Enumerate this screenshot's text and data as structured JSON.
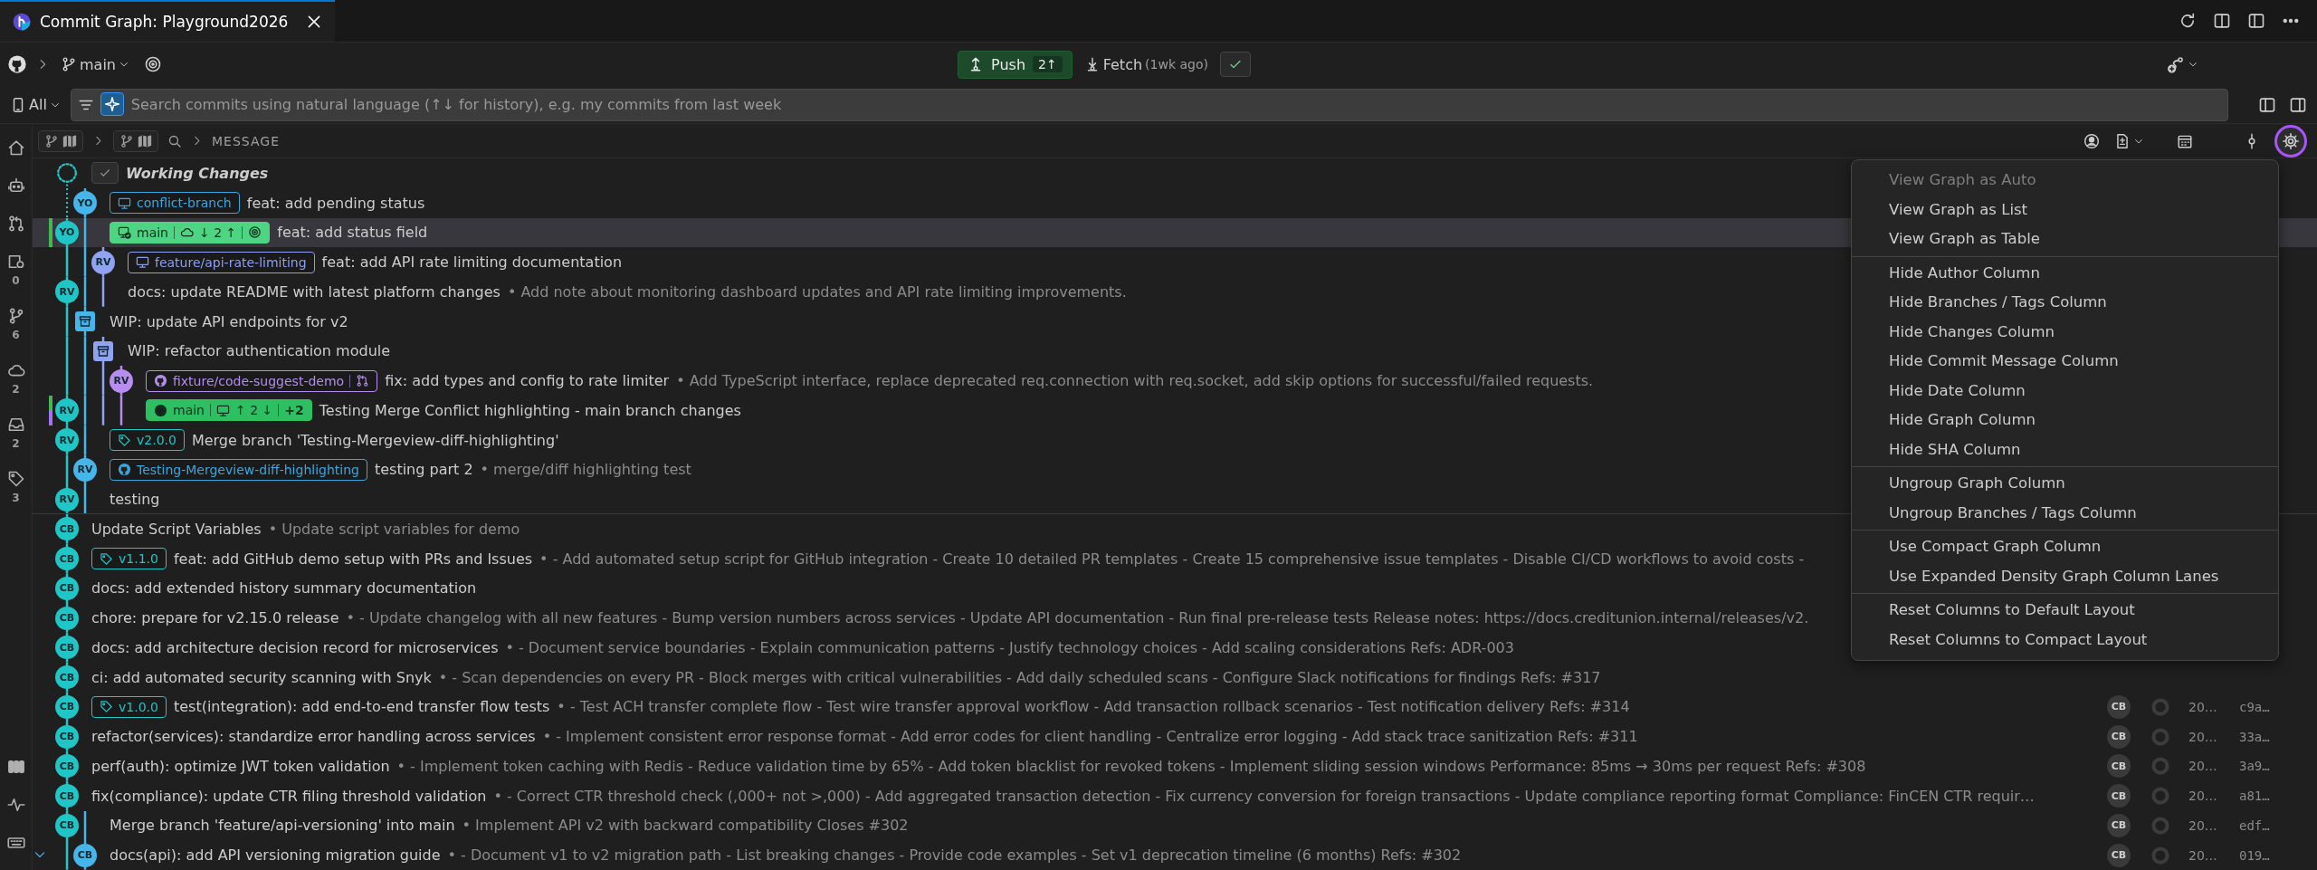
{
  "tab": {
    "title": "Commit Graph: Playground2026",
    "selected": true
  },
  "toolbar": {
    "branch": "main",
    "push": {
      "label": "Push",
      "badge": "2↑"
    },
    "fetch": {
      "label": "Fetch",
      "age": "(1wk ago)"
    }
  },
  "search": {
    "scope": "All",
    "placeholder": "Search commits using natural language (↑↓ for history), e.g. my commits from last week",
    "ai_on": true
  },
  "activity_bar": {
    "top": [
      {
        "kind": "home"
      },
      {
        "kind": "robot"
      },
      {
        "kind": "pull-request"
      },
      {
        "kind": "worktree",
        "count": "0"
      },
      {
        "kind": "branch",
        "count": "6"
      },
      {
        "kind": "cloud",
        "count": "2"
      },
      {
        "kind": "inbox",
        "count": "2"
      },
      {
        "kind": "tag",
        "count": "3"
      }
    ],
    "bottom": [
      {
        "kind": "columns"
      },
      {
        "kind": "pulse"
      },
      {
        "kind": "keyboard"
      }
    ]
  },
  "header": {
    "view_toggles": [
      {
        "selected": true
      },
      {
        "selected": true
      }
    ],
    "message_column": "MESSAGE",
    "settings_highlighted": true
  },
  "rows": [
    {
      "kind": "working",
      "selected": false,
      "summary": "Working Changes"
    },
    {
      "kind": "commit",
      "author": "YO",
      "selected": false,
      "refs": [
        {
          "kind": "local",
          "name": "conflict-branch",
          "color": "#3aa6e0",
          "filled": false
        }
      ],
      "summary": "feat: add pending status"
    },
    {
      "kind": "commit",
      "author": "YO",
      "selected": true,
      "markers": [
        {
          "color": "#3fb950"
        }
      ],
      "refs": [
        {
          "kind": "current",
          "name": "main",
          "color": "#4fd483",
          "filled": true,
          "parts": [
            {
              "kind": "remote",
              "text": "↓ 2 ↑"
            },
            {
              "kind": "upstream"
            }
          ]
        }
      ],
      "summary": "feat: add status field"
    },
    {
      "kind": "commit",
      "author": "RV",
      "selected": false,
      "refs": [
        {
          "kind": "local",
          "name": "feature/api-rate-limiting",
          "color": "#8d9ef0",
          "filled": false
        }
      ],
      "summary": "feat: add API rate limiting documentation"
    },
    {
      "kind": "commit",
      "author": "RV",
      "selected": false,
      "summary": "docs: update README with latest platform changes",
      "description": "• Add note about monitoring dashboard updates and API rate limiting improvements."
    },
    {
      "kind": "stash",
      "selected": false,
      "summary": "WIP: update API endpoints for v2"
    },
    {
      "kind": "stash",
      "selected": false,
      "summary": "WIP: refactor authentication module"
    },
    {
      "kind": "commit",
      "author": "RV",
      "selected": false,
      "refs": [
        {
          "kind": "remote",
          "name": "fixture/code-suggest-demo",
          "color": "#b48cf0",
          "filled": false,
          "parts": [
            {
              "kind": "pull-request"
            }
          ]
        }
      ],
      "summary": "fix: add types and config to rate limiter",
      "description": "• Add TypeScript interface, replace deprecated req.connection with req.socket, add skip options for successful/failed requests."
    },
    {
      "kind": "commit",
      "author": "RV",
      "selected": false,
      "markers": [
        {
          "color": "#3fb950"
        },
        {
          "color": "#a371f7"
        }
      ],
      "refs": [
        {
          "kind": "remote",
          "name": "main",
          "color": "#2fbf63",
          "filled": true,
          "parts": [
            {
              "kind": "local",
              "text": "↑ 2 ↓"
            },
            {
              "kind": "more",
              "text": "+2"
            }
          ]
        }
      ],
      "summary": "Testing Merge Conflict highlighting - main branch changes"
    },
    {
      "kind": "commit",
      "author": "RV",
      "selected": false,
      "refs": [
        {
          "kind": "tag",
          "name": "v2.0.0",
          "color": "#20c5c5",
          "filled": false
        }
      ],
      "summary": "Merge branch 'Testing-Mergeview-diff-highlighting'"
    },
    {
      "kind": "commit",
      "author": "RV",
      "selected": false,
      "refs": [
        {
          "kind": "remote",
          "name": "Testing-Mergeview-diff-highlighting",
          "color": "#3aa6e0",
          "filled": false
        }
      ],
      "summary": "testing part 2",
      "description": "• merge/diff highlighting test"
    },
    {
      "kind": "commit",
      "author": "RV",
      "selected": false,
      "summary": "testing"
    },
    {
      "kind": "commit",
      "author": "CB",
      "selected": false,
      "summary": "Update Script Variables",
      "description": "• Update script variables for demo"
    },
    {
      "kind": "commit",
      "author": "CB",
      "selected": false,
      "refs": [
        {
          "kind": "tag",
          "name": "v1.1.0",
          "color": "#20c5c5",
          "filled": false
        }
      ],
      "summary": "feat: add GitHub demo setup with PRs and Issues",
      "description": "• - Add automated setup script for GitHub integration - Create 10 detailed PR templates - Create 15 comprehensive issue templates - Disable CI/CD workflows to avoid costs -"
    },
    {
      "kind": "commit",
      "author": "CB",
      "selected": false,
      "summary": "docs: add extended history summary documentation"
    },
    {
      "kind": "commit",
      "author": "CB",
      "selected": false,
      "summary": "chore: prepare for v2.15.0 release",
      "description": "• - Update changelog with all new features - Bump version numbers across services - Update API documentation - Run final pre-release tests Release notes: https://docs.creditunion.internal/releases/v2."
    },
    {
      "kind": "commit",
      "author": "CB",
      "selected": false,
      "summary": "docs: add architecture decision record for microservices",
      "description": "• - Document service boundaries - Explain communication patterns - Justify technology choices - Add scaling considerations Refs: ADR-003"
    },
    {
      "kind": "commit",
      "author": "CB",
      "selected": false,
      "summary": "ci: add automated security scanning with Snyk",
      "description": "• - Scan dependencies on every PR - Block merges with critical vulnerabilities - Add daily scheduled scans - Configure Slack notifications for findings Refs: #317"
    },
    {
      "kind": "commit",
      "author": "CB",
      "selected": false,
      "refs": [
        {
          "kind": "tag",
          "name": "v1.0.0",
          "color": "#20c5c5",
          "filled": false
        }
      ],
      "summary": "test(integration): add end-to-end transfer flow tests",
      "description": "• - Test ACH transfer complete flow - Test wire transfer approval workflow - Add transaction rollback scenarios - Test notification delivery Refs: #314",
      "columns": {
        "author": "CB",
        "date": "20…",
        "sha": "c9a…"
      }
    },
    {
      "kind": "commit",
      "author": "CB",
      "selected": false,
      "summary": "refactor(services): standardize error handling across services",
      "description": "• - Implement consistent error response format - Add error codes for client handling - Centralize error logging - Add stack trace sanitization Refs: #311",
      "columns": {
        "author": "CB",
        "date": "20…",
        "sha": "33a…"
      }
    },
    {
      "kind": "commit",
      "author": "CB",
      "selected": false,
      "summary": "perf(auth): optimize JWT token validation",
      "description": "• - Implement token caching with Redis - Reduce validation time by 65% - Add token blacklist for revoked tokens - Implement sliding session windows Performance: 85ms → 30ms per request Refs: #308",
      "columns": {
        "author": "CB",
        "date": "20…",
        "sha": "3a9…"
      }
    },
    {
      "kind": "commit",
      "author": "CB",
      "selected": false,
      "summary": "fix(compliance): update CTR filing threshold validation",
      "description": "• - Correct CTR threshold check (,000+ not >,000) - Add aggregated transaction detection - Fix currency conversion for foreign transactions - Update compliance reporting format Compliance: FinCEN CTR requir…",
      "columns": {
        "author": "CB",
        "date": "20…",
        "sha": "a81…"
      }
    },
    {
      "kind": "commit",
      "author": "CB",
      "selected": false,
      "summary": "Merge branch 'feature/api-versioning' into main",
      "description": "• Implement API v2 with backward compatibility Closes #302",
      "columns": {
        "author": "CB",
        "date": "20…",
        "sha": "edf…"
      }
    },
    {
      "kind": "commit",
      "author": "CB",
      "selected": false,
      "expanded": true,
      "summary": "docs(api): add API versioning migration guide",
      "description": "• - Document v1 to v2 migration path - List breaking changes - Provide code examples - Set v1 deprecation timeline (6 months) Refs: #302",
      "columns": {
        "author": "CB",
        "date": "20…",
        "sha": "019…"
      }
    }
  ],
  "menu": {
    "sections": [
      {
        "items": [
          {
            "label": "View Graph as Auto",
            "disabled": true
          },
          {
            "label": "View Graph as List",
            "disabled": false
          },
          {
            "label": "View Graph as Table",
            "disabled": false
          }
        ]
      },
      {
        "items": [
          {
            "label": "Hide Author Column",
            "disabled": false
          },
          {
            "label": "Hide Branches / Tags Column",
            "disabled": false
          },
          {
            "label": "Hide Changes Column",
            "disabled": false
          },
          {
            "label": "Hide Commit Message Column",
            "disabled": false
          },
          {
            "label": "Hide Date Column",
            "disabled": false
          },
          {
            "label": "Hide Graph Column",
            "disabled": false
          },
          {
            "label": "Hide SHA Column",
            "disabled": false
          }
        ]
      },
      {
        "items": [
          {
            "label": "Ungroup Graph Column",
            "disabled": false
          },
          {
            "label": "Ungroup Branches / Tags Column",
            "disabled": false
          }
        ]
      },
      {
        "items": [
          {
            "label": "Use Compact Graph Column",
            "disabled": false
          },
          {
            "label": "Use Expanded Density Graph Column Lanes",
            "disabled": false
          }
        ]
      },
      {
        "items": [
          {
            "label": "Reset Columns to Default Layout",
            "disabled": false
          },
          {
            "label": "Reset Columns to Compact Layout",
            "disabled": false
          }
        ]
      }
    ]
  }
}
